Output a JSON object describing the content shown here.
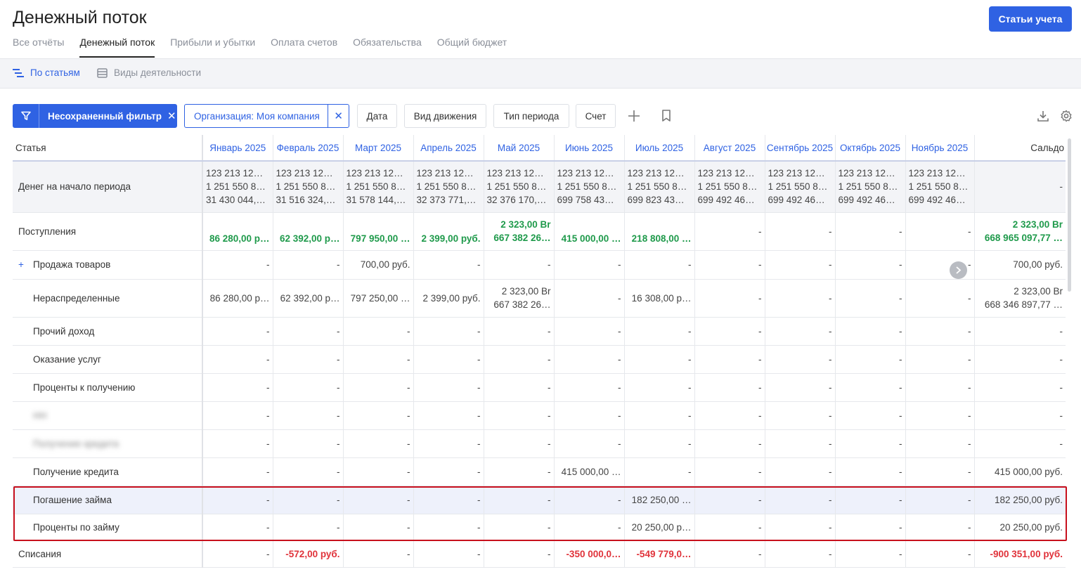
{
  "header": {
    "title": "Денежный поток",
    "accounts_button": "Статьи учета"
  },
  "tabs": [
    "Все отчёты",
    "Денежный поток",
    "Прибыли и убытки",
    "Оплата счетов",
    "Обязательства",
    "Общий бюджет"
  ],
  "active_tab": "Денежный поток",
  "view_tabs": {
    "by_articles": "По статьям",
    "by_activities": "Виды деятельности"
  },
  "filters": {
    "unsaved_filter": "Несохраненный фильтр",
    "organization": "Организация: Моя компания",
    "date": "Дата",
    "movement_type": "Вид движения",
    "period_type": "Тип периода",
    "account": "Счет"
  },
  "table": {
    "columns": [
      "Статья",
      "Январь 2025",
      "Февраль 2025",
      "Март 2025",
      "Апрель 2025",
      "Май 2025",
      "Июнь 2025",
      "Июль 2025",
      "Август 2025",
      "Сентябрь 2025",
      "Октябрь 2025",
      "Ноябрь 2025",
      "Сальдо"
    ],
    "start_row": {
      "label": "Денег на начало периода",
      "cells": [
        [
          "123 213 12…",
          "1 251 550 8…",
          "31 430 044,…"
        ],
        [
          "123 213 12…",
          "1 251 550 8…",
          "31 516 324,…"
        ],
        [
          "123 213 12…",
          "1 251 550 8…",
          "31 578 144,…"
        ],
        [
          "123 213 12…",
          "1 251 550 8…",
          "32 373 771,…"
        ],
        [
          "123 213 12…",
          "1 251 550 8…",
          "32 376 170,…"
        ],
        [
          "123 213 12…",
          "1 251 550 8…",
          "699 758 43…"
        ],
        [
          "123 213 12…",
          "1 251 550 8…",
          "699 823 43…"
        ],
        [
          "123 213 12…",
          "1 251 550 8…",
          "699 492 46…"
        ],
        [
          "123 213 12…",
          "1 251 550 8…",
          "699 492 46…"
        ],
        [
          "123 213 12…",
          "1 251 550 8…",
          "699 492 46…"
        ],
        [
          "123 213 12…",
          "1 251 550 8…",
          "699 492 46…"
        ]
      ],
      "saldo": "-"
    },
    "income_row": {
      "label": "Поступления",
      "cells": [
        [
          "86 280,00 р…"
        ],
        [
          "62 392,00 р…"
        ],
        [
          "797 950,00 …"
        ],
        [
          "2 399,00 руб."
        ],
        [
          "2 323,00 Br",
          "667 382 26…"
        ],
        [
          "415 000,00 …"
        ],
        [
          "218 808,00 …"
        ],
        [
          "-"
        ],
        [
          "-"
        ],
        [
          "-"
        ],
        [
          "-"
        ]
      ],
      "saldo": [
        "2 323,00 Br",
        "668 965 097,77 …"
      ]
    },
    "rows": [
      {
        "label": "Продажа товаров",
        "expand": "+",
        "cells": [
          [
            "-"
          ],
          [
            "-"
          ],
          [
            "700,00 руб."
          ],
          [
            "-"
          ],
          [
            "-"
          ],
          [
            "-"
          ],
          [
            "-"
          ],
          [
            "-"
          ],
          [
            "-"
          ],
          [
            "-"
          ],
          [
            "-"
          ]
        ],
        "saldo": [
          "700,00 руб."
        ]
      },
      {
        "label": "Нераспределенные",
        "cells": [
          [
            "86 280,00 р…"
          ],
          [
            "62 392,00 р…"
          ],
          [
            "797 250,00 …"
          ],
          [
            "2 399,00 руб."
          ],
          [
            "2 323,00 Br",
            "667 382 26…"
          ],
          [
            "-"
          ],
          [
            "16 308,00 р…"
          ],
          [
            "-"
          ],
          [
            "-"
          ],
          [
            "-"
          ],
          [
            "-"
          ]
        ],
        "saldo": [
          "2 323,00 Br",
          "668 346 897,77 …"
        ]
      },
      {
        "label": "Прочий доход",
        "cells": [
          [
            "-"
          ],
          [
            "-"
          ],
          [
            "-"
          ],
          [
            "-"
          ],
          [
            "-"
          ],
          [
            "-"
          ],
          [
            "-"
          ],
          [
            "-"
          ],
          [
            "-"
          ],
          [
            "-"
          ],
          [
            "-"
          ]
        ],
        "saldo": [
          "-"
        ]
      },
      {
        "label": "Оказание услуг",
        "cells": [
          [
            "-"
          ],
          [
            "-"
          ],
          [
            "-"
          ],
          [
            "-"
          ],
          [
            "-"
          ],
          [
            "-"
          ],
          [
            "-"
          ],
          [
            "-"
          ],
          [
            "-"
          ],
          [
            "-"
          ],
          [
            "-"
          ]
        ],
        "saldo": [
          "-"
        ]
      },
      {
        "label": "Проценты к получению",
        "cells": [
          [
            "-"
          ],
          [
            "-"
          ],
          [
            "-"
          ],
          [
            "-"
          ],
          [
            "-"
          ],
          [
            "-"
          ],
          [
            "-"
          ],
          [
            "-"
          ],
          [
            "-"
          ],
          [
            "-"
          ],
          [
            "-"
          ]
        ],
        "saldo": [
          "-"
        ]
      },
      {
        "label": "НН",
        "blurred": true,
        "cells": [
          [
            "-"
          ],
          [
            "-"
          ],
          [
            "-"
          ],
          [
            "-"
          ],
          [
            "-"
          ],
          [
            "-"
          ],
          [
            "-"
          ],
          [
            "-"
          ],
          [
            "-"
          ],
          [
            "-"
          ],
          [
            "-"
          ]
        ],
        "saldo": [
          "-"
        ]
      },
      {
        "label": "Получение кредита",
        "blurred": true,
        "cells": [
          [
            "-"
          ],
          [
            "-"
          ],
          [
            "-"
          ],
          [
            "-"
          ],
          [
            "-"
          ],
          [
            "-"
          ],
          [
            "-"
          ],
          [
            "-"
          ],
          [
            "-"
          ],
          [
            "-"
          ],
          [
            "-"
          ]
        ],
        "saldo": [
          "-"
        ]
      },
      {
        "label": "Получение кредита",
        "cells": [
          [
            "-"
          ],
          [
            "-"
          ],
          [
            "-"
          ],
          [
            "-"
          ],
          [
            "-"
          ],
          [
            "415 000,00 …"
          ],
          [
            "-"
          ],
          [
            "-"
          ],
          [
            "-"
          ],
          [
            "-"
          ],
          [
            "-"
          ]
        ],
        "saldo": [
          "415 000,00 руб."
        ]
      },
      {
        "label": "Погашение займа",
        "highlight": true,
        "cells": [
          [
            "-"
          ],
          [
            "-"
          ],
          [
            "-"
          ],
          [
            "-"
          ],
          [
            "-"
          ],
          [
            "-"
          ],
          [
            "182 250,00 …"
          ],
          [
            "-"
          ],
          [
            "-"
          ],
          [
            "-"
          ],
          [
            "-"
          ]
        ],
        "saldo": [
          "182 250,00 руб."
        ]
      },
      {
        "label": "Проценты по займу",
        "cells": [
          [
            "-"
          ],
          [
            "-"
          ],
          [
            "-"
          ],
          [
            "-"
          ],
          [
            "-"
          ],
          [
            "-"
          ],
          [
            "20 250,00 р…"
          ],
          [
            "-"
          ],
          [
            "-"
          ],
          [
            "-"
          ],
          [
            "-"
          ]
        ],
        "saldo": [
          "20 250,00 руб."
        ]
      }
    ],
    "expense_row": {
      "label": "Списания",
      "cells": [
        [
          "-"
        ],
        [
          "-572,00 руб."
        ],
        [
          "-"
        ],
        [
          "-"
        ],
        [
          "-"
        ],
        [
          "-350 000,0…"
        ],
        [
          "-549 779,0…"
        ],
        [
          "-"
        ],
        [
          "-"
        ],
        [
          "-"
        ],
        [
          "-"
        ]
      ],
      "saldo": [
        "-900 351,00 руб."
      ]
    }
  },
  "colors": {
    "accent": "#2f62e3",
    "positive": "#1f9a4b",
    "negative": "#e0323a",
    "highlight_border": "#c8101d"
  }
}
